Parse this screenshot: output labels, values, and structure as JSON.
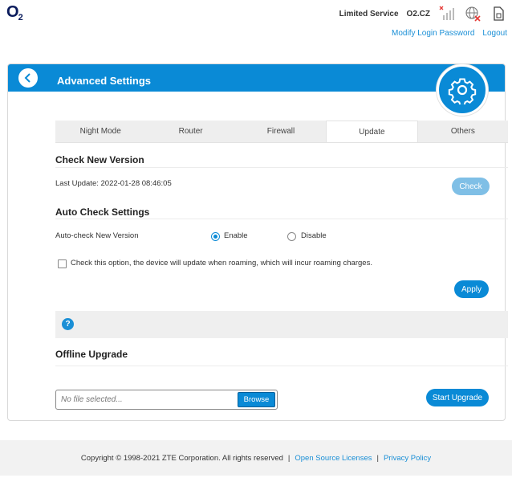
{
  "brand": {
    "logo_main": "O",
    "logo_sub": "2"
  },
  "status": {
    "service": "Limited Service",
    "operator": "O2.CZ"
  },
  "top_links": {
    "modify_password": "Modify Login Password",
    "logout": "Logout"
  },
  "panel": {
    "title": "Advanced Settings"
  },
  "tabs": [
    {
      "label": "Night Mode"
    },
    {
      "label": "Router"
    },
    {
      "label": "Firewall"
    },
    {
      "label": "Update"
    },
    {
      "label": "Others"
    }
  ],
  "active_tab": "Update",
  "check_version": {
    "title": "Check New Version",
    "last_update": "Last Update: 2022-01-28 08:46:05",
    "check_button": "Check"
  },
  "auto_check": {
    "title": "Auto Check Settings",
    "label": "Auto-check New Version",
    "enable_label": "Enable",
    "disable_label": "Disable",
    "selected": "Enable",
    "roaming_label": "Check this option, the device will update when roaming, which will incur roaming charges.",
    "roaming_checked": false,
    "apply_button": "Apply"
  },
  "help": {
    "icon_text": "?"
  },
  "offline_upgrade": {
    "title": "Offline Upgrade",
    "file_placeholder": "No file selected...",
    "browse_button": "Browse",
    "start_button": "Start Upgrade"
  },
  "footer": {
    "copyright": "Copyright © 1998-2021 ZTE Corporation. All rights reserved",
    "separator": "|",
    "open_source": "Open Source Licenses",
    "privacy": "Privacy Policy"
  },
  "colors": {
    "primary": "#0a8ad6",
    "link": "#1a8fd6",
    "check_disabled": "#7fbfe6",
    "error_x": "#e53935"
  }
}
